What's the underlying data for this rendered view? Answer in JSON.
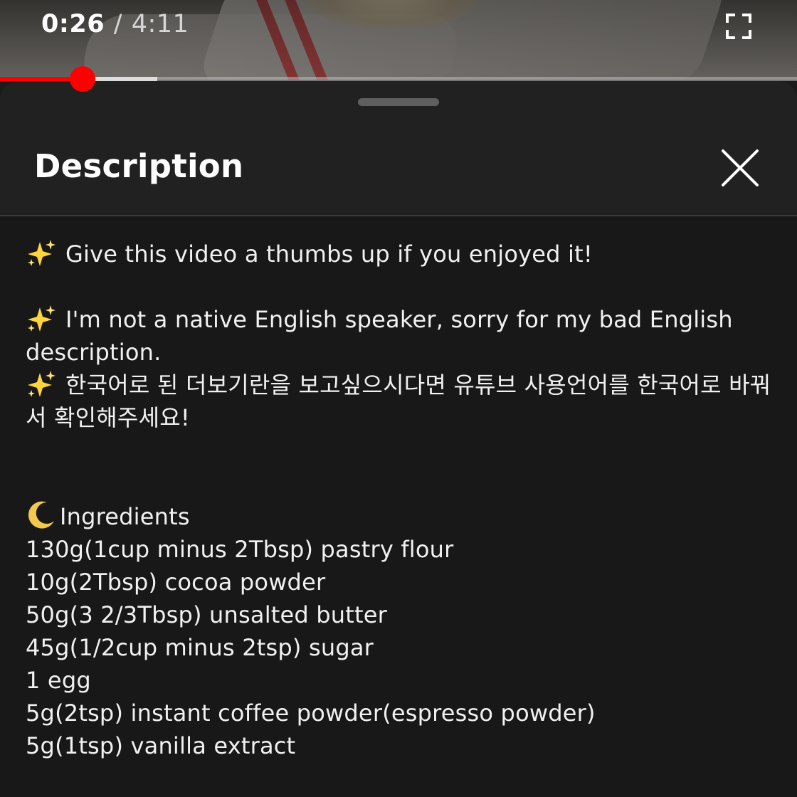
{
  "player": {
    "current_time": "0:26",
    "separator": "/",
    "duration": "4:11",
    "progress_played_fraction": 0.1036,
    "progress_buffered_fraction": 0.197,
    "fullscreen_icon": "fullscreen-icon"
  },
  "sheet": {
    "title": "Description",
    "close_icon": "close-icon"
  },
  "description": {
    "line1": "Give this video a thumbs up if you enjoyed it!",
    "line2": "I'm not a native English speaker, sorry for my bad English description.",
    "line3": "한국어로 된 더보기란을 보고싶으시다면 유튜브 사용언어를 한국어로 바꿔서 확인해주세요!",
    "ingredients_heading": "Ingredients",
    "ingredients": [
      "130g(1cup minus 2Tbsp) pastry flour",
      "10g(2Tbsp) cocoa powder",
      "50g(3 2/3Tbsp) unsalted butter",
      "45g(1/2cup minus 2tsp) sugar",
      "1 egg",
      "5g(2tsp) instant coffee powder(espresso powder)",
      "5g(1tsp) vanilla extract"
    ]
  },
  "colors": {
    "progress_red": "#ff0000",
    "sheet_background": "#212121",
    "body_background": "#181818",
    "sparkle_yellow": "#ffd53d"
  }
}
